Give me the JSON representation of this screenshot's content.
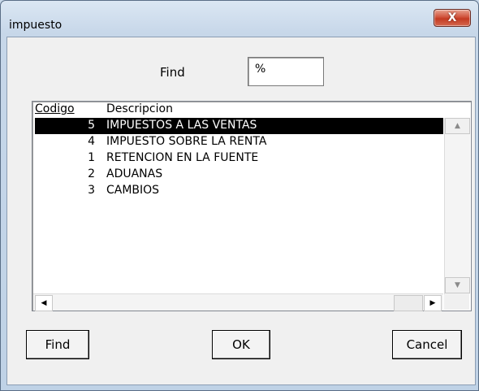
{
  "window": {
    "title": "impuesto",
    "close_label": "X"
  },
  "search": {
    "label": "Find",
    "value": "%"
  },
  "table": {
    "columns": [
      "Codigo",
      "Descripcion"
    ],
    "rows": [
      {
        "codigo": "5",
        "descripcion": "IMPUESTOS A LAS VENTAS",
        "selected": true
      },
      {
        "codigo": "4",
        "descripcion": "IMPUESTO SOBRE LA RENTA",
        "selected": false
      },
      {
        "codigo": "1",
        "descripcion": "RETENCION EN LA FUENTE",
        "selected": false
      },
      {
        "codigo": "2",
        "descripcion": "ADUANAS",
        "selected": false
      },
      {
        "codigo": "3",
        "descripcion": "CAMBIOS",
        "selected": false
      }
    ]
  },
  "icons": {
    "scroll_up": "▲",
    "scroll_down": "▼",
    "scroll_left": "◀",
    "scroll_right": "▶"
  },
  "buttons": {
    "find": "Find",
    "ok": "OK",
    "cancel": "Cancel"
  }
}
